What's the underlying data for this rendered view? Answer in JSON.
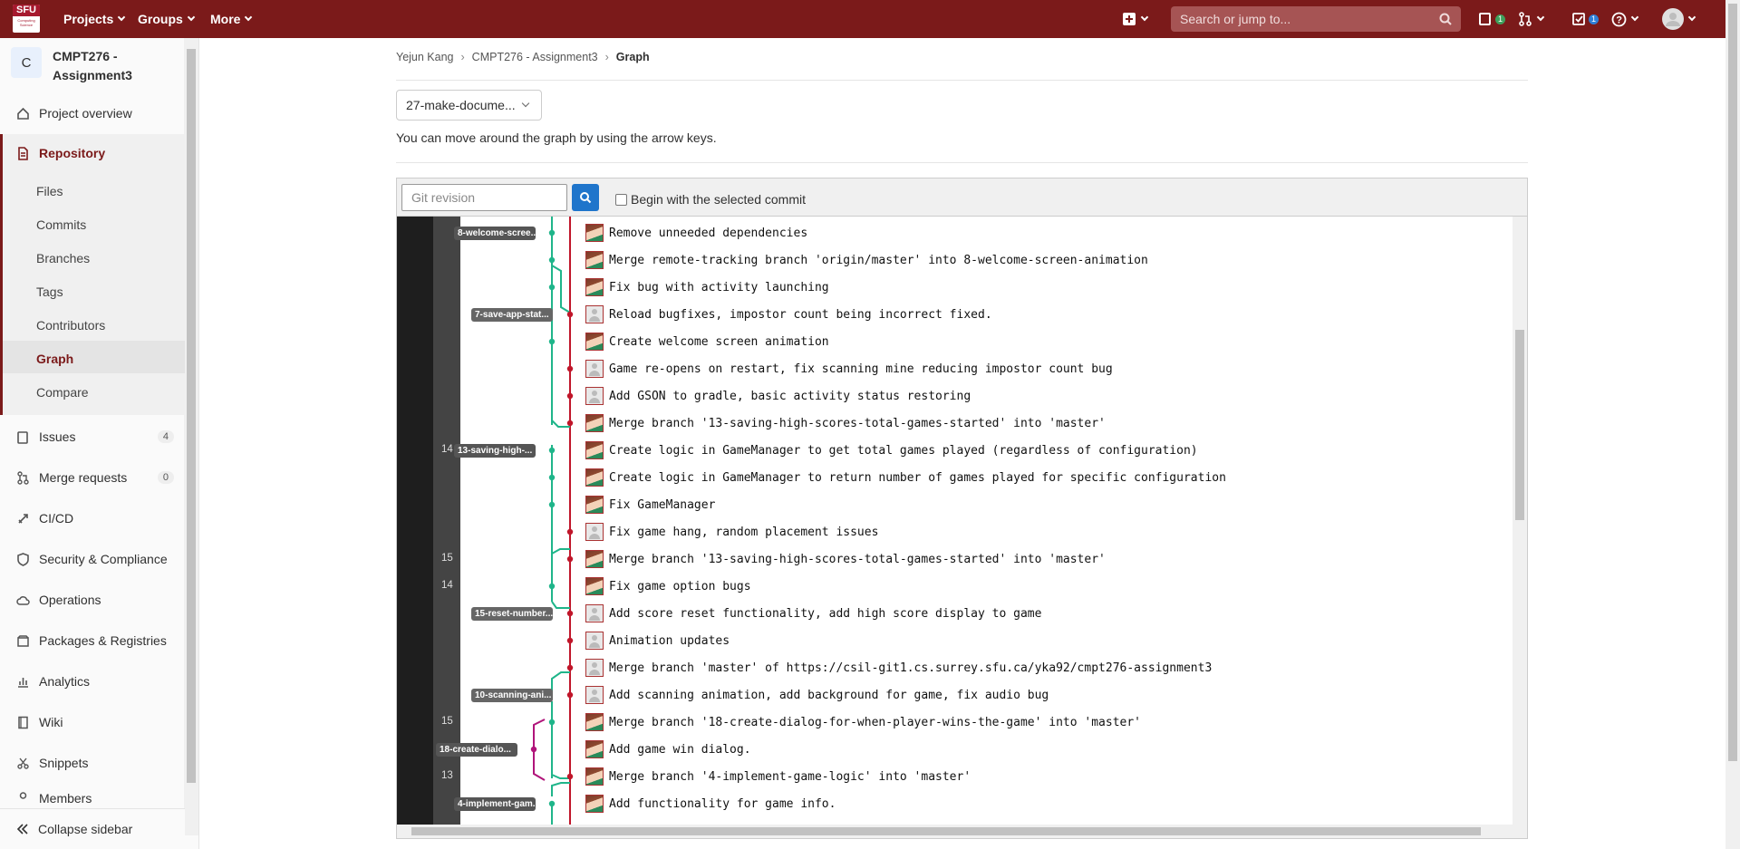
{
  "navbar": {
    "logo_text": "SFU",
    "logo_sub": "Computing Science",
    "projects": "Projects",
    "groups": "Groups",
    "more": "More",
    "search_placeholder": "Search or jump to...",
    "issues_badge": "1",
    "todos_badge": "1"
  },
  "sidebar": {
    "avatar_letter": "C",
    "project_name": "CMPT276 - Assignment3",
    "overview": "Project overview",
    "repository": "Repository",
    "sub": [
      "Files",
      "Commits",
      "Branches",
      "Tags",
      "Contributors",
      "Graph",
      "Compare"
    ],
    "issues": "Issues",
    "issues_count": "4",
    "merge_requests": "Merge requests",
    "merge_requests_count": "0",
    "cicd": "CI/CD",
    "security": "Security & Compliance",
    "operations": "Operations",
    "packages": "Packages & Registries",
    "analytics": "Analytics",
    "wiki": "Wiki",
    "snippets": "Snippets",
    "members": "Members",
    "collapse": "Collapse sidebar"
  },
  "breadcrumb": {
    "owner": "Yejun Kang",
    "project": "CMPT276 - Assignment3",
    "current": "Graph"
  },
  "branch_select": "27-make-docume...",
  "hint": "You can move around the graph by using the arrow keys.",
  "toolbar": {
    "revision_placeholder": "Git revision",
    "begin_label": "Begin with the selected commit"
  },
  "branch_labels": [
    "8-welcome-scree...",
    "7-save-app-stat...",
    "13-saving-high-...",
    "15-reset-number...",
    "10-scanning-ani...",
    "18-create-dialo...",
    "4-implement-gam..."
  ],
  "day_numbers": [
    "14",
    "15",
    "14",
    "15",
    "13"
  ],
  "commits": [
    {
      "msg": "Remove unneeded dependencies",
      "avatar": "photo"
    },
    {
      "msg": "Merge remote-tracking branch 'origin/master' into 8-welcome-screen-animation",
      "avatar": "photo"
    },
    {
      "msg": "Fix bug with activity launching",
      "avatar": "photo"
    },
    {
      "msg": "Reload bugfixes, impostor count being incorrect fixed.",
      "avatar": "default"
    },
    {
      "msg": "Create welcome screen animation",
      "avatar": "photo"
    },
    {
      "msg": "Game re-opens on restart, fix scanning mine reducing impostor count bug",
      "avatar": "default"
    },
    {
      "msg": "Add GSON to gradle, basic activity status restoring",
      "avatar": "default"
    },
    {
      "msg": "Merge branch '13-saving-high-scores-total-games-started' into 'master'",
      "avatar": "photo"
    },
    {
      "msg": "Create logic in GameManager to get total games played (regardless of configuration)",
      "avatar": "photo"
    },
    {
      "msg": "Create logic in GameManager to return number of games played for specific configuration",
      "avatar": "photo"
    },
    {
      "msg": "Fix GameManager",
      "avatar": "photo"
    },
    {
      "msg": "Fix game hang, random placement issues",
      "avatar": "default"
    },
    {
      "msg": "Merge branch '13-saving-high-scores-total-games-started' into 'master'",
      "avatar": "photo"
    },
    {
      "msg": "Fix game option bugs",
      "avatar": "photo"
    },
    {
      "msg": "Add score reset functionality, add high score display to game",
      "avatar": "default"
    },
    {
      "msg": "Animation updates",
      "avatar": "default"
    },
    {
      "msg": "Merge branch 'master' of https://csil-git1.cs.surrey.sfu.ca/yka92/cmpt276-assignment3",
      "avatar": "default"
    },
    {
      "msg": "Add scanning animation, add background for game, fix audio bug",
      "avatar": "default"
    },
    {
      "msg": "Merge branch '18-create-dialog-for-when-player-wins-the-game' into 'master'",
      "avatar": "photo"
    },
    {
      "msg": "Add game win dialog.",
      "avatar": "photo"
    },
    {
      "msg": "Merge branch '4-implement-game-logic' into 'master'",
      "avatar": "photo"
    },
    {
      "msg": "Add functionality for game info.",
      "avatar": "photo"
    }
  ],
  "colors": {
    "navbar": "#7b1a1a",
    "master_line": "#c0162a",
    "branch_line": "#1fb58a",
    "dialog_line": "#b0147a",
    "primary_button": "#1f75cb"
  }
}
